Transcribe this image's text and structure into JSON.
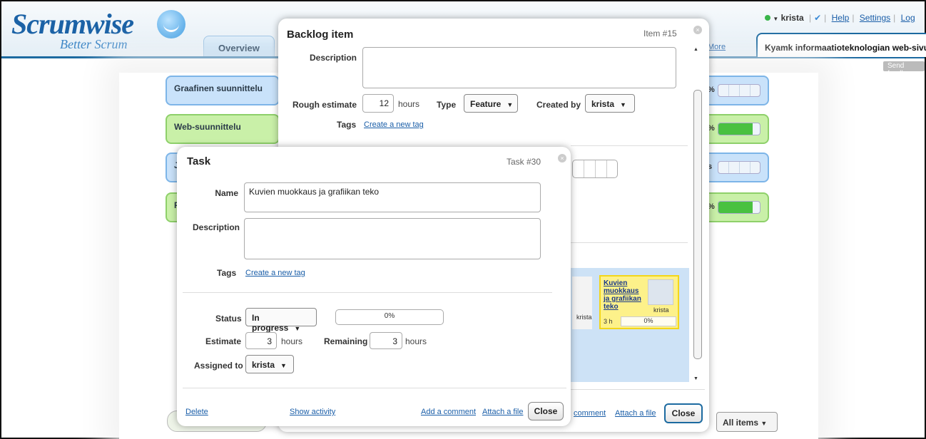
{
  "app": {
    "logo": "Scrumwise",
    "tagline": "Better Scrum",
    "tabs": {
      "overview": "Overview",
      "more": "More"
    },
    "project": "Kyamk informaatioteknologian web-sivut",
    "user": "krista",
    "links": {
      "help": "Help",
      "settings": "Settings",
      "logout": "Log"
    },
    "send_feedback": "Send feedb"
  },
  "board": {
    "epics": [
      {
        "name": "Graafinen suunnittelu",
        "color": "#c9e2fa",
        "pct": "%"
      },
      {
        "name": "Web-suunnittelu",
        "color": "#c9f0a8",
        "pct": "%"
      },
      {
        "name": "J",
        "color": "#c9e2fa",
        "pct": "s"
      },
      {
        "name": "F",
        "color": "#c9f0a8",
        "pct": "%"
      }
    ],
    "all_items": "All items"
  },
  "backlog_item": {
    "title": "Backlog item",
    "number": "Item #15",
    "description_label": "Description",
    "description": "",
    "rough_estimate_label": "Rough estimate",
    "rough_estimate": "12",
    "rough_estimate_unit": "hours",
    "type_label": "Type",
    "type": "Feature",
    "created_by_label": "Created by",
    "created_by": "krista",
    "tags_label": "Tags",
    "create_tag": "Create a new tag",
    "add_comment": "comment",
    "attach_file": "Attach a file",
    "close": "Close",
    "task_card": {
      "title": "Kuvien muokkaus ja grafiikan teko",
      "user": "krista",
      "estimate": "3 h",
      "progress": "0%"
    },
    "left_card_user": "krista"
  },
  "task": {
    "title": "Task",
    "number": "Task #30",
    "name_label": "Name",
    "name": "Kuvien muokkaus ja grafiikan teko",
    "description_label": "Description",
    "description": "",
    "tags_label": "Tags",
    "create_tag": "Create a new tag",
    "status_label": "Status",
    "status": "In progress",
    "progress": "0%",
    "estimate_label": "Estimate",
    "estimate": "3",
    "estimate_unit": "hours",
    "remaining_label": "Remaining",
    "remaining": "3",
    "remaining_unit": "hours",
    "assigned_label": "Assigned to",
    "assigned": "krista",
    "delete": "Delete",
    "show_activity": "Show activity",
    "add_comment": "Add a comment",
    "attach_file": "Attach a file",
    "close": "Close"
  }
}
